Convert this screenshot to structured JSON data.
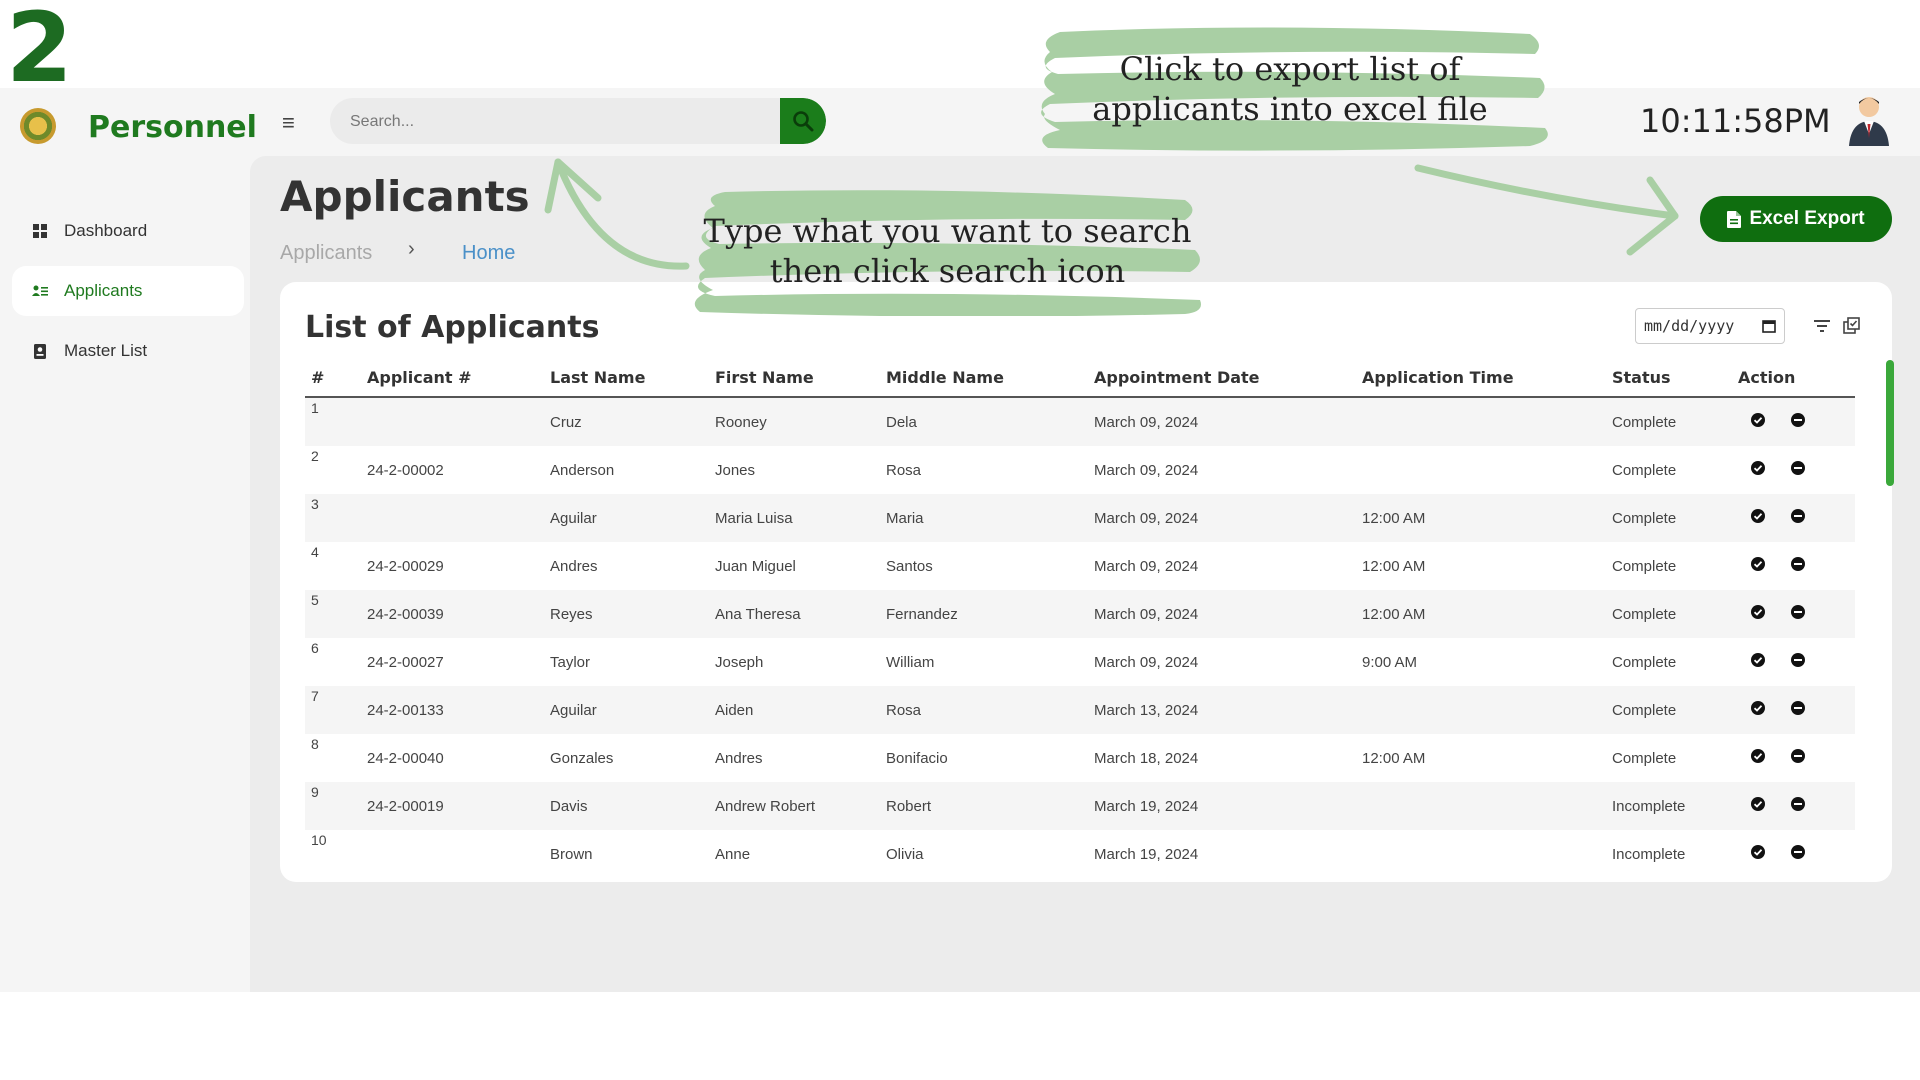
{
  "step_number": "2",
  "app": {
    "brand": "Personnel",
    "search_placeholder": "Search...",
    "clock": "10:11:58PM"
  },
  "sidebar": {
    "items": [
      {
        "label": "Dashboard",
        "icon": "grid-icon",
        "active": false
      },
      {
        "label": "Applicants",
        "icon": "person-list-icon",
        "active": true
      },
      {
        "label": "Master List",
        "icon": "badge-icon",
        "active": false
      }
    ]
  },
  "main": {
    "title": "Applicants",
    "breadcrumb": [
      "Applicants",
      "Home"
    ],
    "breadcrumb_separator": "›",
    "excel_button": "Excel Export",
    "card_title": "List of Applicants",
    "date_placeholder": "mm/dd/yyyy"
  },
  "table": {
    "headers": [
      "#",
      "Applicant #",
      "Last Name",
      "First Name",
      "Middle Name",
      "Appointment Date",
      "Application Time",
      "Status",
      "Action"
    ],
    "rows": [
      [
        "1",
        "",
        "Cruz",
        "Rooney",
        "Dela",
        "March 09, 2024",
        "",
        "Complete"
      ],
      [
        "2",
        "24-2-00002",
        "Anderson",
        "Jones",
        "Rosa",
        "March 09, 2024",
        "",
        "Complete"
      ],
      [
        "3",
        "",
        "Aguilar",
        "Maria Luisa",
        "Maria",
        "March 09, 2024",
        "12:00 AM",
        "Complete"
      ],
      [
        "4",
        "24-2-00029",
        "Andres",
        "Juan Miguel",
        "Santos",
        "March 09, 2024",
        "12:00 AM",
        "Complete"
      ],
      [
        "5",
        "24-2-00039",
        "Reyes",
        "Ana Theresa",
        "Fernandez",
        "March 09, 2024",
        "12:00 AM",
        "Complete"
      ],
      [
        "6",
        "24-2-00027",
        "Taylor",
        "Joseph",
        "William",
        "March 09, 2024",
        "9:00 AM",
        "Complete"
      ],
      [
        "7",
        "24-2-00133",
        "Aguilar",
        "Aiden",
        "Rosa",
        "March 13, 2024",
        "",
        "Complete"
      ],
      [
        "8",
        "24-2-00040",
        "Gonzales",
        "Andres",
        "Bonifacio",
        "March 18, 2024",
        "12:00 AM",
        "Complete"
      ],
      [
        "9",
        "24-2-00019",
        "Davis",
        "Andrew Robert",
        "Robert",
        "March 19, 2024",
        "",
        "Incomplete"
      ],
      [
        "10",
        "",
        "Brown",
        "Anne",
        "Olivia",
        "March 19, 2024",
        "",
        "Incomplete"
      ]
    ]
  },
  "annotations": {
    "export_note": "Click to export list of\napplicants into excel file",
    "search_note": "Type what you want to search\nthen click search icon"
  },
  "colors": {
    "brand_green": "#1f7a1f",
    "button_green": "#0f6e0f",
    "annotation_green": "#a9cfa4",
    "link_blue": "#4a90c8"
  }
}
